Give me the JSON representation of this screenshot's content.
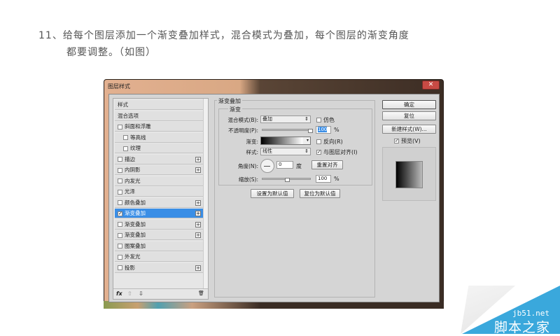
{
  "instruction": {
    "line1": "11、给每个图层添加一个渐变叠加样式，混合模式为叠加，每个图层的渐变角度",
    "line2": "都要调整。（如图）"
  },
  "dialog": {
    "title": "图层样式",
    "close_icon": "close-icon",
    "styles": [
      {
        "label": "样式",
        "checkbox": false,
        "plus": false,
        "indent": 0
      },
      {
        "label": "混合选项",
        "checkbox": false,
        "plus": false,
        "indent": 0
      },
      {
        "label": "斜面和浮雕",
        "checkbox": true,
        "checked": false,
        "plus": false,
        "indent": 0
      },
      {
        "label": "等高线",
        "checkbox": true,
        "checked": false,
        "plus": false,
        "indent": 1
      },
      {
        "label": "纹理",
        "checkbox": true,
        "checked": false,
        "plus": false,
        "indent": 1
      },
      {
        "label": "描边",
        "checkbox": true,
        "checked": false,
        "plus": true,
        "indent": 0
      },
      {
        "label": "内阴影",
        "checkbox": true,
        "checked": false,
        "plus": true,
        "indent": 0
      },
      {
        "label": "内发光",
        "checkbox": true,
        "checked": false,
        "plus": false,
        "indent": 0
      },
      {
        "label": "光泽",
        "checkbox": true,
        "checked": false,
        "plus": false,
        "indent": 0
      },
      {
        "label": "颜色叠加",
        "checkbox": true,
        "checked": false,
        "plus": true,
        "indent": 0
      },
      {
        "label": "渐变叠加",
        "checkbox": true,
        "checked": true,
        "plus": true,
        "indent": 0,
        "selected": true
      },
      {
        "label": "渐变叠加",
        "checkbox": true,
        "checked": false,
        "plus": true,
        "indent": 0
      },
      {
        "label": "渐变叠加",
        "checkbox": true,
        "checked": false,
        "plus": true,
        "indent": 0
      },
      {
        "label": "图案叠加",
        "checkbox": true,
        "checked": false,
        "plus": false,
        "indent": 0
      },
      {
        "label": "外发光",
        "checkbox": true,
        "checked": false,
        "plus": false,
        "indent": 0
      },
      {
        "label": "投影",
        "checkbox": true,
        "checked": false,
        "plus": true,
        "indent": 0
      }
    ],
    "toolbar": {
      "fx": "fx",
      "up": "⇧",
      "down": "⇩",
      "trash": "🗑"
    },
    "panel": {
      "title": "渐变叠加",
      "group": "渐变",
      "blend_label": "混合模式(B):",
      "blend_value": "叠加",
      "dither_label": "仿色",
      "dither_checked": false,
      "opacity_label": "不透明度(P):",
      "opacity_value": "100",
      "opacity_unit": "%",
      "opacity_fraction": 1.0,
      "gradient_label": "渐变:",
      "reverse_label": "反向(R)",
      "reverse_checked": false,
      "style_label": "样式:",
      "style_value": "线性",
      "align_label": "与图层对齐(I)",
      "align_checked": true,
      "angle_label": "角度(N):",
      "angle_value": "0",
      "angle_unit": "度",
      "reset_align": "重置对齐",
      "scale_label": "缩放(S):",
      "scale_value": "100",
      "scale_unit": "%",
      "scale_fraction": 0.5,
      "set_default": "设置为默认值",
      "reset_default": "复位为默认值"
    },
    "buttons": {
      "ok": "确定",
      "reset": "复位",
      "new_style": "新建样式(W)...",
      "preview_label": "预览(V)",
      "preview_checked": true
    }
  },
  "watermark": {
    "url": "jb51.net",
    "name": "脚本之家",
    "color": "#3aa8dc"
  }
}
